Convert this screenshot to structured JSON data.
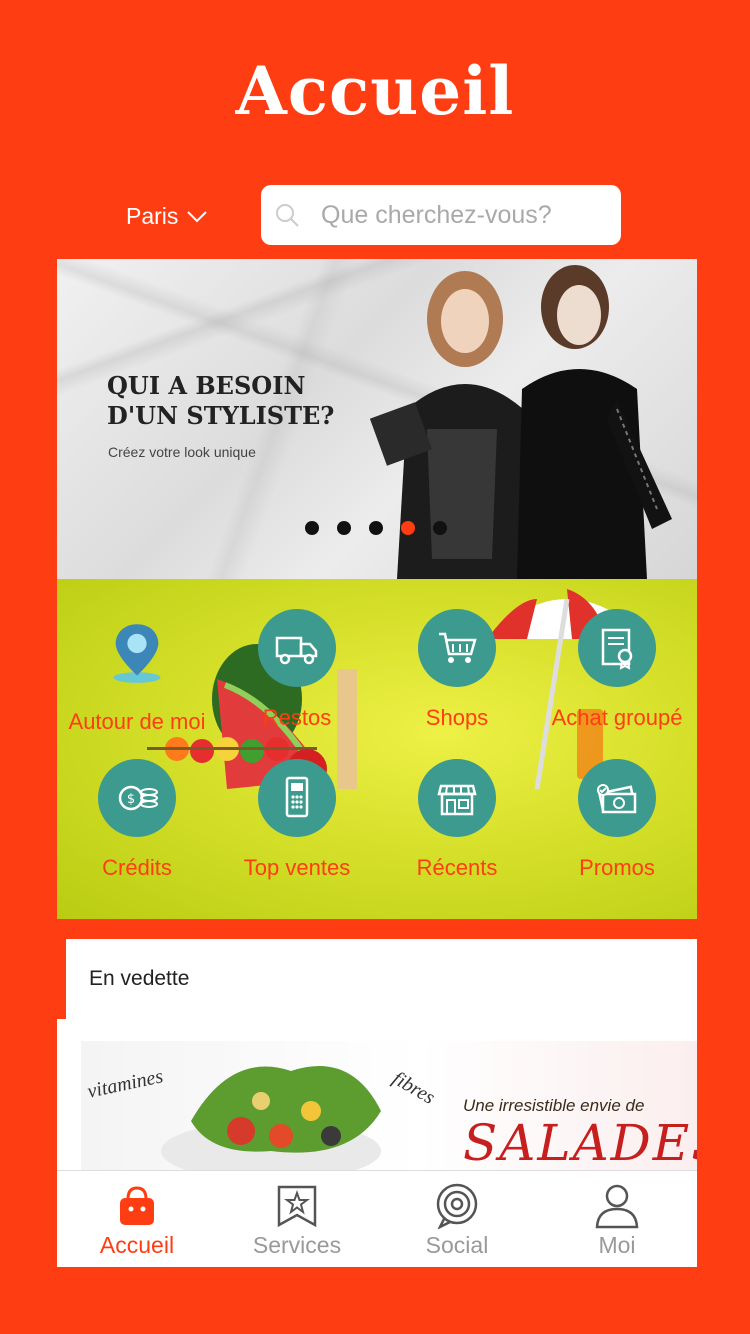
{
  "header": {
    "title": "Accueil"
  },
  "location": {
    "city": "Paris"
  },
  "search": {
    "placeholder": "Que cherchez-vous?"
  },
  "banner": {
    "headline": "QUI A BESOIN D'UN STYLISTE?",
    "subtitle": "Créez votre look unique",
    "slide_count": 5,
    "active_slide": 4
  },
  "categories": [
    {
      "label": "Autour de moi",
      "icon": "map-pin-icon"
    },
    {
      "label": "Restos",
      "icon": "delivery-truck-icon"
    },
    {
      "label": "Shops",
      "icon": "shopping-cart-icon"
    },
    {
      "label": "Achat groupé",
      "icon": "certificate-icon"
    },
    {
      "label": "Crédits",
      "icon": "coins-icon"
    },
    {
      "label": "Top ventes",
      "icon": "payment-terminal-icon"
    },
    {
      "label": "Récents",
      "icon": "storefront-icon"
    },
    {
      "label": "Promos",
      "icon": "money-bills-icon"
    }
  ],
  "featured": {
    "title": "En vedette",
    "image_text": {
      "left_note": "vitamines",
      "right_note": "fibres",
      "tagline": "Une irresistible envie de",
      "brand": "SALADES"
    }
  },
  "tabbar": {
    "tabs": [
      {
        "label": "Accueil",
        "icon": "shopping-bag-icon",
        "active": true
      },
      {
        "label": "Services",
        "icon": "star-bookmark-icon",
        "active": false
      },
      {
        "label": "Social",
        "icon": "target-icon",
        "active": false
      },
      {
        "label": "Moi",
        "icon": "user-icon",
        "active": false
      }
    ]
  },
  "colors": {
    "accent": "#ff3d12",
    "teal": "#3d9a8e",
    "lime": "#d6e02a"
  }
}
